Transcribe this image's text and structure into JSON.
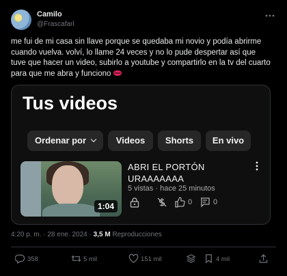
{
  "tweet": {
    "author_name": "Camilo",
    "author_handle": "@Frascafarl",
    "text": "me fui de mi casa sin llave porque se quedaba mi novio y podía abrirme cuando vuelva. volví, lo llame 24 veces y no lo pude despertar así que tuve que hacer un video, subirlo a youtube y compartirlo en la tv del cuarto para que me abra y funciono"
  },
  "media": {
    "page_title": "Tus videos",
    "chips": [
      "Ordenar por",
      "Videos",
      "Shorts",
      "En vivo"
    ],
    "video": {
      "title_line1": "ABRI EL PORTÓN",
      "title_line2": "URAAAAAAA",
      "views": "5 vistas",
      "age": "hace 25 minutos",
      "duration": "1:04",
      "likes": "0",
      "comments": "0"
    }
  },
  "meta": {
    "time": "4:20 p. m. · 28 ene. 2024 ·",
    "views_count": "3,5 M",
    "views_label": "Reproducciones"
  },
  "actions": {
    "replies": "358",
    "reposts": "5 mil",
    "likes": "151 mil",
    "bookmarks": "4 mil"
  },
  "colors": {
    "background": "#000000",
    "text_primary": "#e7e9ea",
    "text_secondary": "#71767b",
    "card_bg": "#0f0f0f",
    "chip_bg": "#272727"
  }
}
